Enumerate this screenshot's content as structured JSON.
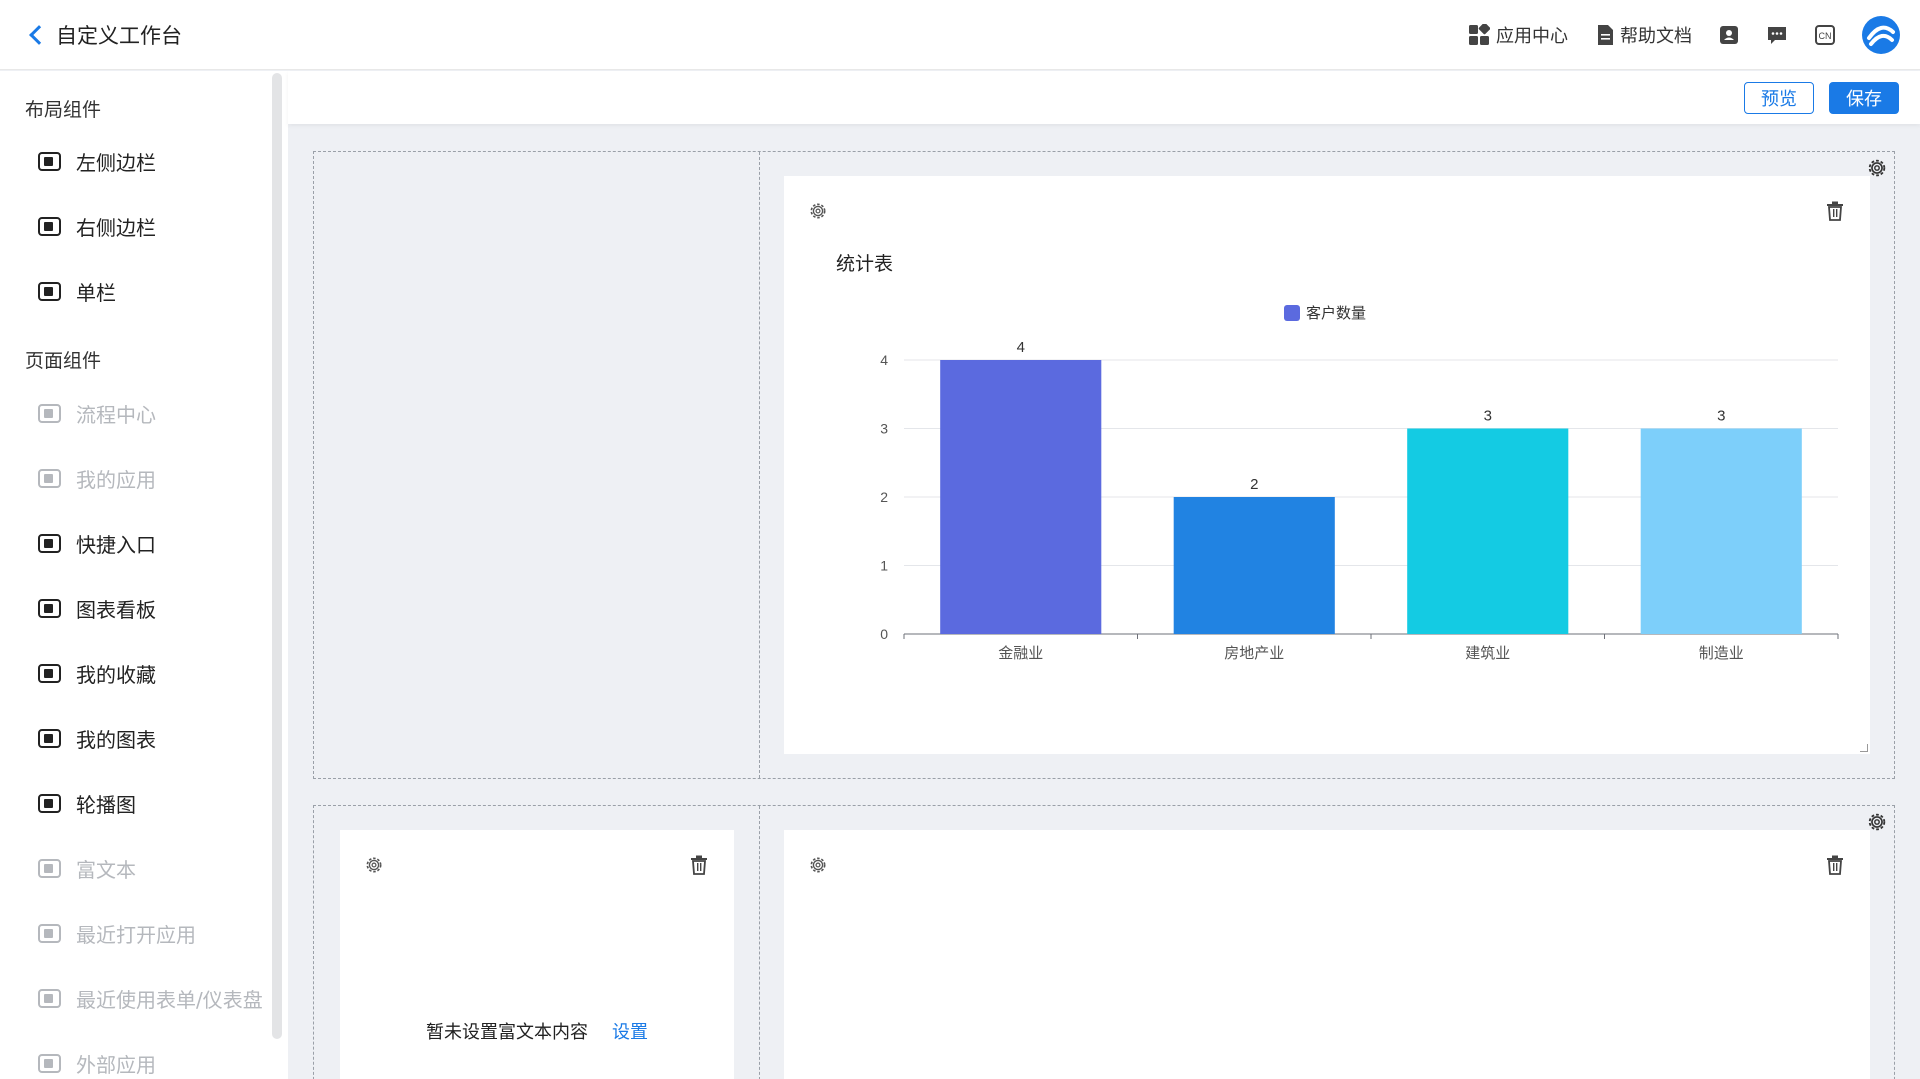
{
  "header": {
    "title": "自定义工作台",
    "app_center": "应用中心",
    "help_docs": "帮助文档",
    "lang": "CN"
  },
  "toolbar": {
    "preview_label": "预览",
    "save_label": "保存"
  },
  "sidebar": {
    "layout_title": "布局组件",
    "layout_items": [
      {
        "label": "左侧边栏",
        "icon": "left-sidebar-icon",
        "disabled": false
      },
      {
        "label": "右侧边栏",
        "icon": "right-sidebar-icon",
        "disabled": false
      },
      {
        "label": "单栏",
        "icon": "single-column-icon",
        "disabled": false
      }
    ],
    "page_title": "页面组件",
    "page_items": [
      {
        "label": "流程中心",
        "icon": "process-center-icon",
        "disabled": true
      },
      {
        "label": "我的应用",
        "icon": "my-apps-icon",
        "disabled": true
      },
      {
        "label": "快捷入口",
        "icon": "shortcut-icon",
        "disabled": false
      },
      {
        "label": "图表看板",
        "icon": "chart-board-icon",
        "disabled": false
      },
      {
        "label": "我的收藏",
        "icon": "favorites-icon",
        "disabled": false
      },
      {
        "label": "我的图表",
        "icon": "my-charts-icon",
        "disabled": false
      },
      {
        "label": "轮播图",
        "icon": "carousel-icon",
        "disabled": false
      },
      {
        "label": "富文本",
        "icon": "rich-text-icon",
        "disabled": true
      },
      {
        "label": "最近打开应用",
        "icon": "recent-apps-icon",
        "disabled": true
      },
      {
        "label": "最近使用表单/仪表盘",
        "icon": "recent-forms-icon",
        "disabled": true
      },
      {
        "label": "外部应用",
        "icon": "external-apps-icon",
        "disabled": true
      }
    ]
  },
  "chart_card": {
    "title": "统计表"
  },
  "rich_text_card": {
    "empty_text": "暂未设置富文本内容",
    "set_link": "设置"
  },
  "colors": {
    "accent": "#1a7ae6",
    "bar_colors": [
      "#5b6adf",
      "#2183e2",
      "#14cbe3",
      "#7dcffa"
    ]
  },
  "chart_data": {
    "type": "bar",
    "title": "统计表",
    "categories": [
      "金融业",
      "房地产业",
      "建筑业",
      "制造业"
    ],
    "series": [
      {
        "name": "客户数量",
        "values": [
          4,
          2,
          3,
          3
        ]
      }
    ],
    "ylim": [
      0,
      4
    ],
    "yticks": [
      0,
      1,
      2,
      3,
      4
    ],
    "legend": "top-center",
    "grid": true
  }
}
